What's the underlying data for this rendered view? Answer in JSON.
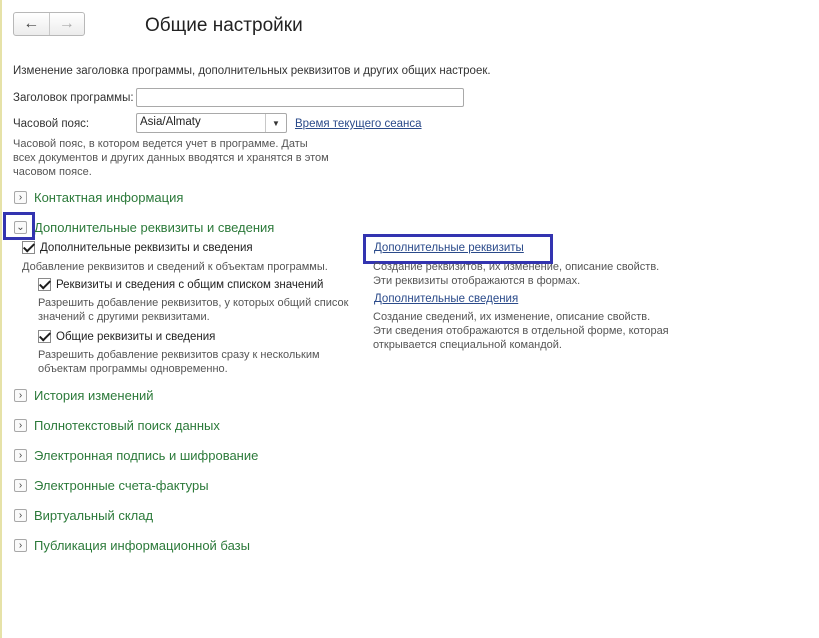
{
  "window": {
    "title": "Общие настройки",
    "nav": {
      "back_icon": "arrow-left-icon",
      "forward_icon": "arrow-right-icon"
    }
  },
  "description": "Изменение заголовка программы, дополнительных реквизитов и других общих настроек.",
  "form": {
    "program_title_label": "Заголовок программы:",
    "program_title_value": "",
    "timezone_label": "Часовой пояс:",
    "timezone_value": "Asia/Almaty",
    "session_time_link": "Время текущего сеанса",
    "timezone_hint": [
      "Часовой пояс, в котором ведется учет в программе. Даты",
      "всех документов и других данных вводятся и хранятся в этом",
      "часовом поясе."
    ]
  },
  "sections": {
    "contact": "Контактная информация",
    "additional": "Дополнительные реквизиты и сведения",
    "history": "История изменений",
    "fulltext": "Полнотекстовый поиск данных",
    "signature": "Электронная подпись и шифрование",
    "invoices": "Электронные счета-фактуры",
    "warehouse": "Виртуальный склад",
    "publication": "Публикация информационной базы"
  },
  "additional_panel": {
    "main_checkbox": "Дополнительные реквизиты и сведения",
    "main_hint": "Добавление реквизитов и сведений к объектам программы.",
    "list_checkbox": "Реквизиты и сведения с общим списком значений",
    "list_hint": [
      "Разрешить добавление реквизитов, у которых общий список",
      "значений с другими реквизитами."
    ],
    "common_checkbox": "Общие реквизиты и сведения",
    "common_hint": [
      "Разрешить добавление реквизитов сразу к нескольким",
      "объектам программы одновременно."
    ],
    "req_link": "Дополнительные реквизиты",
    "req_hint": [
      "Создание реквизитов, их изменение, описание свойств.",
      "Эти реквизиты отображаются в формах."
    ],
    "info_link": "Дополнительные сведения",
    "info_hint": [
      "Создание сведений, их изменение, описание свойств.",
      "Эти сведения отображаются в отдельной форме, которая",
      "открывается специальной командой."
    ]
  },
  "colors": {
    "section_title": "#2c7a3a",
    "link": "#2a4a8a",
    "highlight": "#3334b0"
  }
}
